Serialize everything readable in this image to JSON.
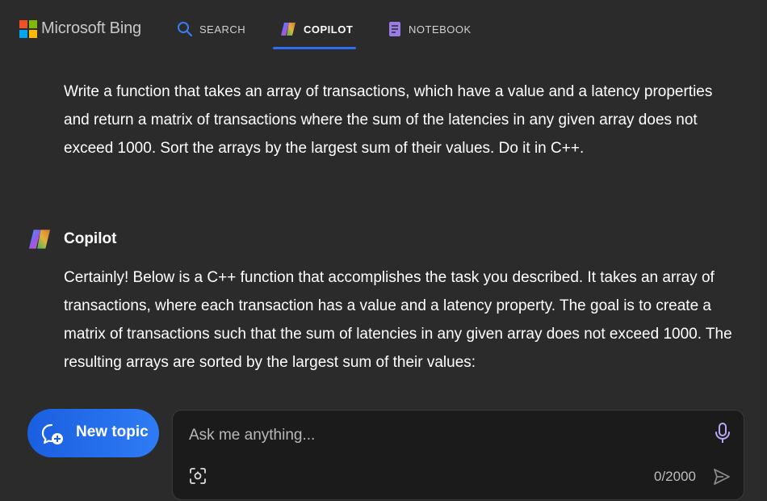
{
  "header": {
    "brand": "Microsoft Bing",
    "nav": [
      {
        "label": "SEARCH",
        "icon": "search-icon",
        "active": false
      },
      {
        "label": "COPILOT",
        "icon": "copilot-icon",
        "active": true
      },
      {
        "label": "NOTEBOOK",
        "icon": "notebook-icon",
        "active": false
      }
    ],
    "accent": "#2f6ef0"
  },
  "conversation": {
    "user_message": "Write a function that takes an array of transactions, which have a value and a latency properties and return a matrix of transactions where the sum of the latencies in any given array does not exceed 1000. Sort the arrays by the largest sum of their values. Do it in C++.",
    "assistant_name": "Copilot",
    "assistant_message": "Certainly! Below is a C++ function that accomplishes the task you described. It takes an array of transactions, where each transaction has a value and a latency property. The goal is to create a matrix of transactions such that the sum of latencies in any given array does not exceed 1000. The resulting arrays are sorted by the largest sum of their values:"
  },
  "composer": {
    "new_topic_label": "New topic",
    "placeholder": "Ask me anything...",
    "value": "",
    "char_count": "0/2000",
    "icons": [
      "new-topic-icon",
      "mic-icon",
      "visual-search-icon",
      "send-icon"
    ]
  },
  "colors": {
    "background": "#2b2b2b",
    "input_background": "#1b1b1b",
    "new_topic_gradient": [
      "#1a5fe0",
      "#2f7bf5"
    ]
  }
}
